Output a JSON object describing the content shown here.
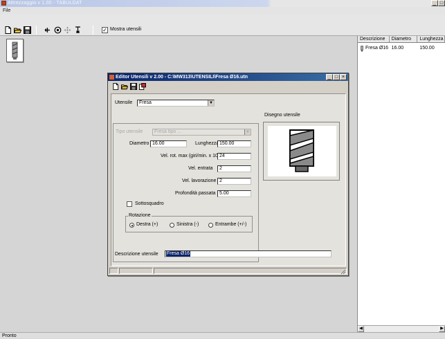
{
  "app": {
    "title": "Attrezzaggio v 1.00 - TABULDAT",
    "window_buttons": [
      "_",
      "□"
    ]
  },
  "menubar": {
    "file": "File"
  },
  "toolbar": {
    "mostra_utensili": "Mostra utensili",
    "mostra_checked": "✓"
  },
  "tool_list": {
    "columns": [
      "Descrizione",
      "Diametro",
      "Lunghezza"
    ],
    "rows": [
      {
        "descrizione": "Fresa Ø16",
        "diametro": "16.00",
        "lunghezza": "150.00"
      }
    ]
  },
  "statusbar": {
    "text": "Pronto"
  },
  "dialog": {
    "title": "Editor Utensili v 2.00 - C:\\MW313\\UTENSILI\\Fresa Ø16.utn",
    "window_buttons": [
      "_",
      "□",
      "×"
    ],
    "utensile_label": "Utensile",
    "utensile_value": "Fresa",
    "tipo_label": "Tipo utensile",
    "tipo_value": "Fresa tipo ...",
    "diametro_label": "Diametro",
    "diametro_value": "16.00",
    "lunghezza_label": "Lunghezza",
    "lunghezza_value": "150.00",
    "vel_rot_label": "Vel. rot. max (giri/min. x 1000)",
    "vel_rot_value": "24",
    "vel_entrata_label": "Vel. entrata",
    "vel_entrata_value": "2",
    "vel_lavorazione_label": "Vel. lavorazione",
    "vel_lavorazione_value": "2",
    "profondita_label": "Profondità passata",
    "profondita_value": "5.00",
    "sottosquadro_label": "Sottosquadro",
    "rotazione_title": "Rotazione",
    "rotazione_options": [
      "Destra (+)",
      "Sinistra (-)",
      "Entrambe (+/-)"
    ],
    "disegno_label": "Disegno utensile",
    "descrizione_label": "Descrizione utensile",
    "descrizione_value": "Fresa Ø16"
  },
  "colors": {
    "dialog_titlebar": "#0a246a",
    "selection": "#0a246a",
    "window_bg": "#d5d5d5"
  }
}
